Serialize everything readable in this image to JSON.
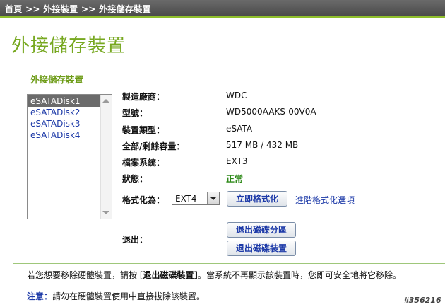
{
  "breadcrumb": "首頁 >> 外接裝置 >> 外接儲存裝置",
  "page_title": "外接儲存裝置",
  "section_legend": "外接儲存裝置",
  "disks": [
    {
      "label": "eSATADisk1",
      "selected": true
    },
    {
      "label": "eSATADisk2",
      "selected": false
    },
    {
      "label": "eSATADisk3",
      "selected": false
    },
    {
      "label": "eSATADisk4",
      "selected": false
    }
  ],
  "info": {
    "manufacturer_label": "製造廠商：",
    "manufacturer_value": "WDC",
    "model_label": "型號：",
    "model_value": "WD5000AAKS-00V0A",
    "type_label": "裝置類型：",
    "type_value": "eSATA",
    "capacity_label": "全部/剩餘容量：",
    "capacity_value": "517 MB / 432 MB",
    "fs_label": "檔案系統：",
    "fs_value": "EXT3",
    "status_label": "狀態：",
    "status_value": "正常"
  },
  "format": {
    "label": "格式化為：",
    "selected": "EXT4",
    "button": "立即格式化",
    "advanced_link": "進階格式化選項"
  },
  "eject": {
    "label": "退出：",
    "partition_button": "退出磁碟分區",
    "device_button": "退出磁碟裝置"
  },
  "notes": {
    "line1_pre": "若您想要移除硬體裝置，請按 [",
    "line1_bold": "退出磁碟裝置]",
    "line1_post": "。當系統不再顯示該裝置時，您即可安全地將它移除。",
    "line2_label": "注意：",
    "line2_text": "請勿在硬體裝置使用中直接拔除該裝置。"
  },
  "watermark": "#356216",
  "colors": {
    "accent_green": "#77a820",
    "link_blue": "#1d3aa8",
    "status_ok": "#2f8a1a"
  }
}
